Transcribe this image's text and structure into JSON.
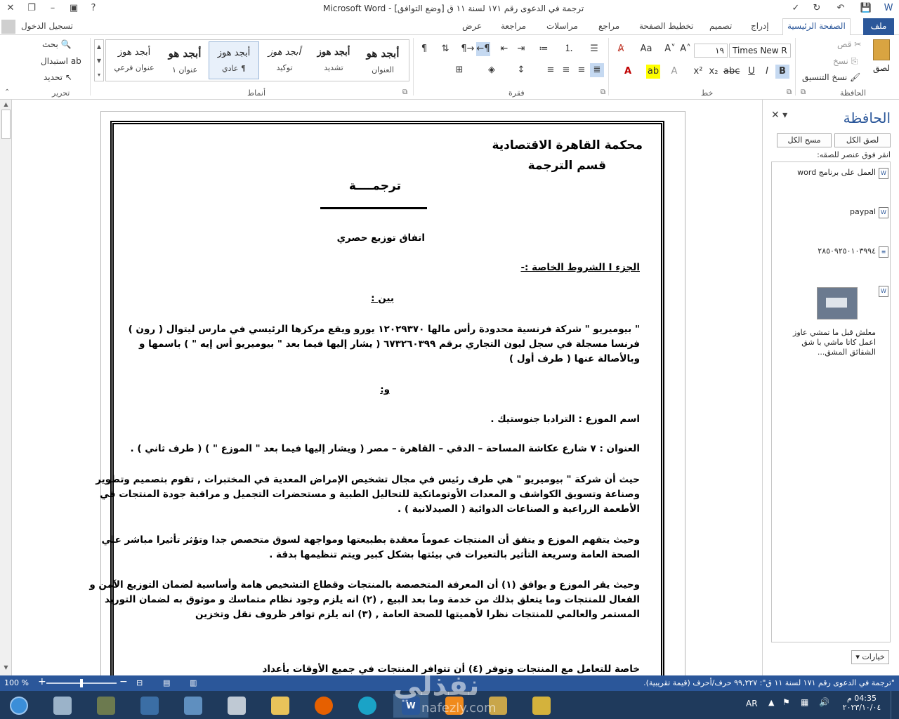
{
  "titlebar": {
    "title": "ترجمة في الدعوى رقم ١٧١ لسنة ١١ ق [وضع التوافق] - Microsoft Word",
    "help": "?",
    "minimize": "–",
    "restore": "❐",
    "close": "✕"
  },
  "tabs": {
    "file": "ملف",
    "home": "الصفحة الرئيسية",
    "insert": "إدراج",
    "design": "تصميم",
    "layout": "تخطيط الصفحة",
    "references": "مراجع",
    "mailings": "مراسلات",
    "review": "مراجعة",
    "view": "عرض",
    "signin": "تسجيل الدخول"
  },
  "ribbon": {
    "clipboard": {
      "label": "الحافظة",
      "paste": "لصق",
      "cut": "قص",
      "copy": "نسخ",
      "format_painter": "نسخ التنسيق"
    },
    "font": {
      "label": "خط",
      "font_name": "Times New R",
      "font_size": "١٩"
    },
    "paragraph": {
      "label": "فقرة"
    },
    "styles": {
      "label": "أنماط",
      "items": [
        {
          "preview": "أبجد هو",
          "name": "العنوان"
        },
        {
          "preview": "أبجد هوز",
          "name": "تشديد"
        },
        {
          "preview": "أبجد هوز",
          "name": "توكيد"
        },
        {
          "preview": "أبجد هوز",
          "name": "¶ عادي"
        },
        {
          "preview": "أبجد هو",
          "name": "عنوان ١"
        },
        {
          "preview": "أبجد هوز",
          "name": "عنوان فرعي"
        }
      ]
    },
    "editing": {
      "label": "تحرير",
      "find": "بحث",
      "replace": "استبدال",
      "select": "تحديد"
    }
  },
  "document": {
    "header1": "محكمة القاهرة الاقتصادية",
    "header2": "قسم الترجمة",
    "title": "ترجمــــة",
    "agreement": "اتفاق توزيع حصري",
    "part": "الجزء  I  الشروط الخاصة :-",
    "between": "بين :",
    "p1": [
      "\" بيوميريو \" شركة فرنسية محدودة رأس مالها  ١٢٠٢٩٣٧٠ يورو ويقع مركزها الرئيسي في مارس ليتوال ( رون )",
      "فرنسا مسجلة في سجل ليون التجاري برقم  ٦٧٣٢٦٠٣٩٩  ( يشار إليها فيما بعد \" بيوميريو أس إيه \" ) باسمها و",
      "وبالأصالة عنها ( طرف أول )"
    ],
    "and": "و:",
    "distributor": "اسم الموزع : الترادبا جنوستيك .",
    "address": "العنوان : ٧ شارع عكاشة المساحة – الدقي – القاهرة – مصر ( ويشار إليها فيما بعد \" الموزع \" ) ( طرف ثاني ) .",
    "p2": [
      "حيث أن شركة \" بيوميريو \" هي طرف رئيس في مجال تشخيص الإمراض المعدية في المختبرات , تقوم بتصميم وتطوير",
      "وصناعة وتسويق الكواشف و المعدات الأوتوماتكية للتحاليل الطبية و مستحضرات التجميل و مراقبة جودة المنتجات في",
      "الأطعمة الزراعية و الصناعات الدوائية ( الصيدلانية ) ."
    ],
    "p3": [
      "وحيث يتفهم الموزع و يتفق أن المنتجات عموماً معقدة بطبيعتها ومواجهة لسوق متخصص جدا وتؤثر تأثيرا مباشر علي",
      "الصحة العامة وسريعة التأثير بالتغيرات في بيئتها بشكل كبير ويتم تنظيمها بدقة ."
    ],
    "p4": [
      "وحيث يقر الموزع و يوافق (١) أن المعرفة المتخصصة بالمنتجات وقطاع التشخيص هامة وأساسية لضمان التوزيع الآمن و",
      "الفعال  للمنتجات وما يتعلق بذلك من خدمة وما بعد البيع ,  (٢) انه يلزم وجود نظام متماسك و موثوق به لضمان التوريد",
      "المستمر والعالمي للمنتجات نظرا لأهميتها للصحة العامة  , (٣) انه يلزم توافر ظروف نقل وتخزين"
    ],
    "p5_partial": "خاصة للتعامل مع المنتجات وتوفر (٤) أن تتوافر المنتجات في جميع الأوقات بأعداد"
  },
  "clipboard_pane": {
    "title": "الحافظة",
    "paste_all": "لصق الكل",
    "clear_all": "مسح الكل",
    "hint": "انقر فوق عنصر للصقه:",
    "items": [
      "العمل على برنامج word",
      "paypal",
      "٢٨٥٠٩٢٥٠١٠٣٩٩٤",
      "",
      "معلش قبل ما تمشي عاوز اعمل كاتا ماشي با شق الشقائق المشق..."
    ],
    "options": "خيارات"
  },
  "statusbar": {
    "zoom": "100 %",
    "info": "\"ترجمة في الدعوى رقم ١٧١ لسنة ١١ ق\": ٩٩,٢٢٧ حرف/أحرف (قيمة تقريبية)."
  },
  "taskbar": {
    "lang": "AR",
    "time": "04:35 م",
    "date": "٢٠٢٣/١٠/٠٤"
  },
  "watermark": {
    "text": "نفذلي",
    "url": "nafezly.com"
  },
  "colors": {
    "accent": "#2b579a",
    "taskbar": "#1f3a5c"
  }
}
